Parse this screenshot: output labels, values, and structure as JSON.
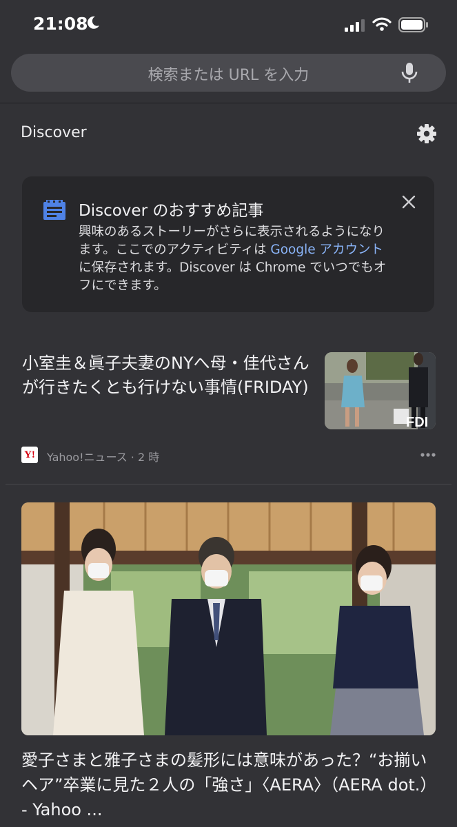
{
  "status": {
    "time": "21:08"
  },
  "search": {
    "placeholder": "検索または URL を入力"
  },
  "discover": {
    "title": "Discover"
  },
  "card": {
    "title": "Discover のおすすめ記事",
    "body_before": "興味のあるストーリーがさらに表示されるようになります。ここでのアクティビティは ",
    "body_link": "Google アカウント",
    "body_after": "に保存されます。Discover は Chrome でいつでもオフにできます。"
  },
  "story1": {
    "title": "小室圭＆眞子夫妻のNYへ母・佳代さんが行きたくとも行けない事情(FRIDAY)",
    "source": "Yahoo!ニュース · 2 時",
    "logo": "Y!"
  },
  "story2": {
    "title": "愛子さまと雅子さまの髪形には意味があった？“お揃いヘア”卒業に見た２人の「強さ」〈AERA〉（AERA dot.） - Yahoo ..."
  },
  "icons": {
    "moon": "moon-icon",
    "signal": "signal-icon",
    "wifi": "wifi-icon",
    "battery": "battery-icon",
    "mic": "mic-icon",
    "gear": "gear-icon",
    "news": "news-icon",
    "close": "close-icon",
    "more": "more-icon"
  },
  "colors": {
    "background": "#323236",
    "card": "#27272a",
    "link": "#8ab4f8",
    "search_bar": "#4a4a4f"
  }
}
